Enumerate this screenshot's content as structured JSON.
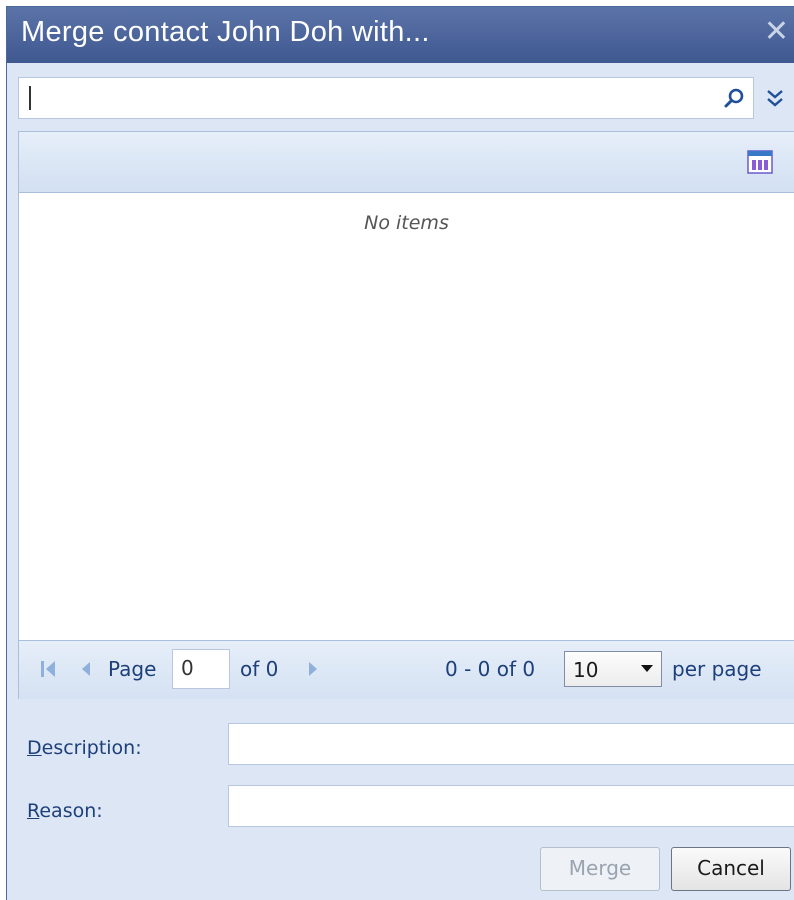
{
  "dialog": {
    "title": "Merge contact John Doh with...",
    "close_icon": "close-icon"
  },
  "search": {
    "value": "",
    "search_icon": "search-icon",
    "expand_icon": "double-chevron-down-icon"
  },
  "grid": {
    "column_chooser_icon": "column-chooser-icon",
    "empty_text": "No items"
  },
  "pager": {
    "page_label": "Page",
    "page_value": "0",
    "of_label": "of 0",
    "range_text": "0 - 0 of 0",
    "page_size": "10",
    "per_page_label": "per page"
  },
  "form": {
    "description_label_accel": "D",
    "description_label_rest": "escription:",
    "description_value": "",
    "reason_label_accel": "R",
    "reason_label_rest": "eason:",
    "reason_value": ""
  },
  "buttons": {
    "merge_label": "Merge",
    "cancel_label": "Cancel"
  },
  "colors": {
    "title_bar": "#4a639a",
    "dialog_bg": "#dce6f4",
    "link_text": "#1d3f7a"
  }
}
